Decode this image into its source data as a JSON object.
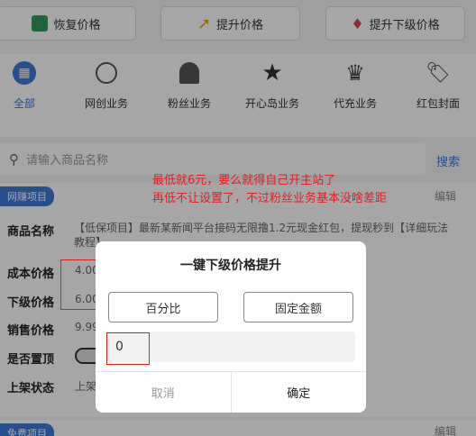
{
  "top_buttons": [
    {
      "label": "恢复价格",
      "icon": "restore-icon",
      "color": "#2e9c5b"
    },
    {
      "label": "提升价格",
      "icon": "arrow-up-icon",
      "color": "#f0a020"
    },
    {
      "label": "提升下级价格",
      "icon": "diamond-icon",
      "color": "#e0404a"
    }
  ],
  "categories": [
    {
      "label": "全部",
      "icon": "grid-icon",
      "active": true
    },
    {
      "label": "网创业务",
      "icon": "globe-icon"
    },
    {
      "label": "粉丝业务",
      "icon": "user-chart-icon"
    },
    {
      "label": "开心岛业务",
      "icon": "star-icon"
    },
    {
      "label": "代充业务",
      "icon": "crown-icon"
    },
    {
      "label": "红包封面",
      "icon": "tag-icon"
    }
  ],
  "search": {
    "placeholder": "请输入商品名称",
    "button": "搜索"
  },
  "product": {
    "tag": "网赚项目",
    "edit": "编辑",
    "name_label": "商品名称",
    "name_value": "【低保项目】最新某新闻平台接码无限撸1.2元现金红包，提现秒到【详细玩法教程】",
    "cost_label": "成本价格",
    "cost_value": "4.00",
    "sub_label": "下级价格",
    "sub_value": "6.00",
    "sale_label": "销售价格",
    "sale_value": "9.99",
    "top_label": "是否置顶",
    "status_label": "上架状态",
    "status_value": "上架"
  },
  "product2": {
    "tag": "免费项目",
    "edit": "编辑"
  },
  "annotation": {
    "line1": "最低就6元，要么就得自己开主站了",
    "line2": "再低不让设置了，不过粉丝业务基本没啥差距"
  },
  "modal": {
    "title": "一键下级价格提升",
    "btn_percent": "百分比",
    "btn_fixed": "固定金额",
    "input_value": "0",
    "cancel": "取消",
    "confirm": "确定"
  }
}
